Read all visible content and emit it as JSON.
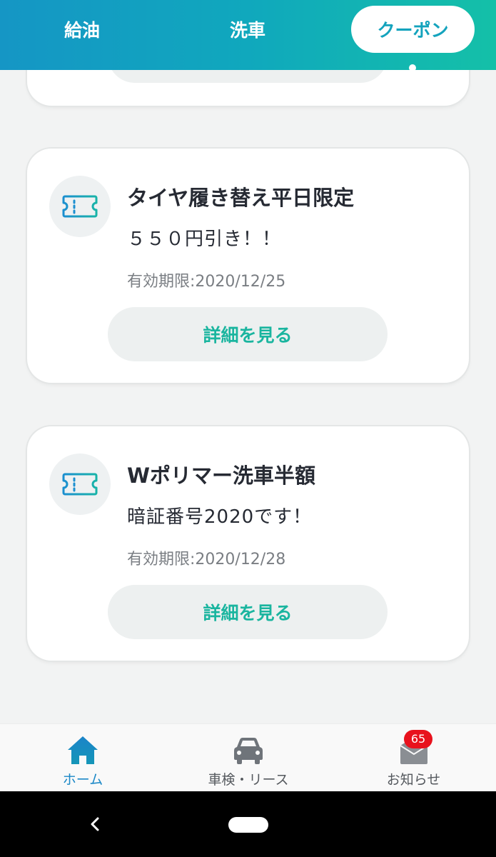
{
  "top_tabs": [
    {
      "label": "給油"
    },
    {
      "label": "洗車"
    },
    {
      "label": "クーポン"
    }
  ],
  "active_tab": "クーポン",
  "coupons": [
    {
      "title": "タイヤ履き替え平日限定",
      "description": "５５０円引き！！",
      "expiry": "有効期限:2020/12/25",
      "button_label": "詳細を見る",
      "icon": "ticket-icon"
    },
    {
      "title": "Wポリマー洗車半額",
      "description": "暗証番号2020です！",
      "expiry": "有効期限:2020/12/28",
      "button_label": "詳細を見る",
      "icon": "ticket-icon"
    }
  ],
  "bottom_nav": [
    {
      "label": "ホーム",
      "icon": "home-icon",
      "active": true
    },
    {
      "label": "車検・リース",
      "icon": "car-icon",
      "active": false
    },
    {
      "label": "お知らせ",
      "icon": "mail-icon",
      "active": false,
      "badge": "65"
    }
  ],
  "system_nav": {
    "back_glyph": "‹"
  },
  "colors": {
    "header_gradient_start": "#1596c5",
    "header_gradient_end": "#14c0a8",
    "accent_teal": "#1ab59f",
    "active_nav_blue": "#1b88c7",
    "badge_red": "#e8121d",
    "background": "#f2f3f3"
  }
}
